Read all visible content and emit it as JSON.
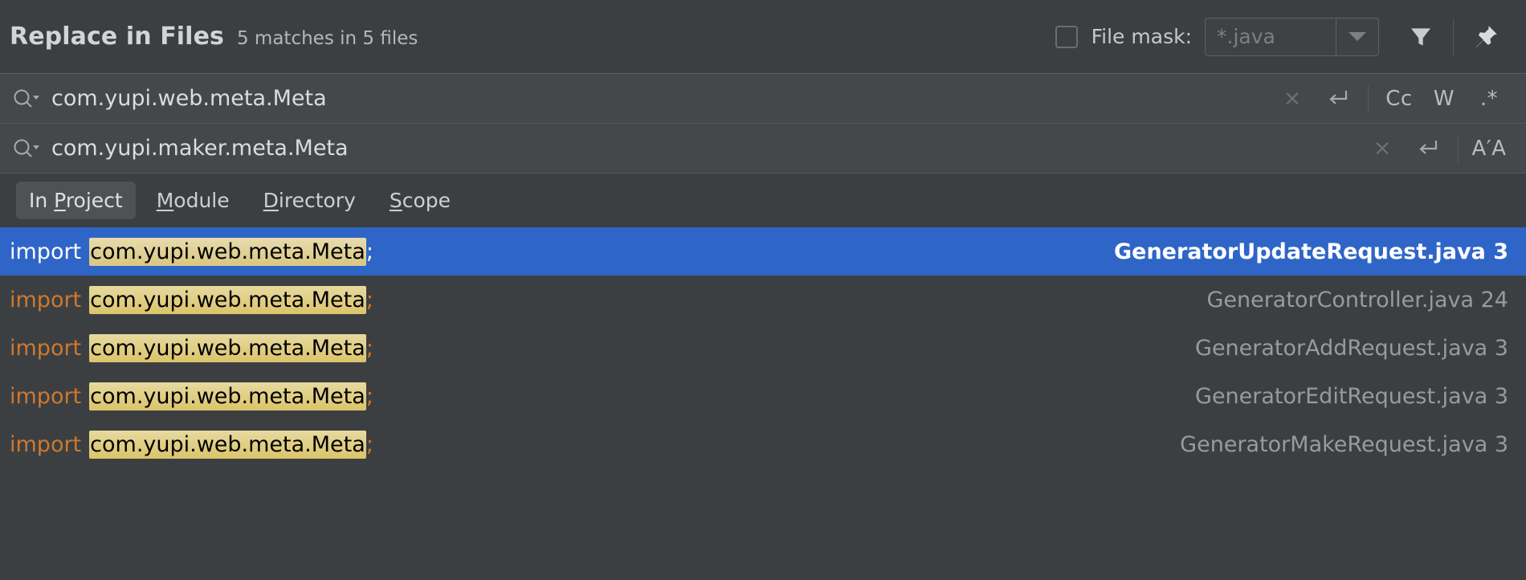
{
  "header": {
    "title": "Replace in Files",
    "match_summary": "5 matches in 5 files",
    "file_mask_label": "File mask:",
    "file_mask_value": "*.java",
    "file_mask_checked": false,
    "filter_icon": "filter-funnel-icon",
    "pin_icon": "pin-icon"
  },
  "search_field": {
    "icon": "search-icon",
    "value": "com.yupi.web.meta.Meta",
    "clear_label": "×",
    "history_label": "↵",
    "toggles": [
      {
        "name": "match-case",
        "label": "Cc"
      },
      {
        "name": "words",
        "label": "W"
      },
      {
        "name": "regex",
        "label": ".*"
      }
    ]
  },
  "replace_field": {
    "icon": "search-icon",
    "value": "com.yupi.maker.meta.Meta",
    "clear_label": "×",
    "history_label": "↵",
    "preserve_case_label": "A′A"
  },
  "scope_tabs": [
    {
      "name": "in-project",
      "pre": "In ",
      "mnemonic": "P",
      "post": "roject",
      "selected": true
    },
    {
      "name": "module",
      "pre": "",
      "mnemonic": "M",
      "post": "odule",
      "selected": false
    },
    {
      "name": "directory",
      "pre": "",
      "mnemonic": "D",
      "post": "irectory",
      "selected": false
    },
    {
      "name": "scope",
      "pre": "",
      "mnemonic": "S",
      "post": "cope",
      "selected": false
    }
  ],
  "results": [
    {
      "keyword": "import",
      "match": "com.yupi.web.meta.Meta",
      "terminator": ";",
      "file": "GeneratorUpdateRequest.java 3",
      "selected": true
    },
    {
      "keyword": "import",
      "match": "com.yupi.web.meta.Meta",
      "terminator": ";",
      "file": "GeneratorController.java 24",
      "selected": false
    },
    {
      "keyword": "import",
      "match": "com.yupi.web.meta.Meta",
      "terminator": ";",
      "file": "GeneratorAddRequest.java 3",
      "selected": false
    },
    {
      "keyword": "import",
      "match": "com.yupi.web.meta.Meta",
      "terminator": ";",
      "file": "GeneratorEditRequest.java 3",
      "selected": false
    },
    {
      "keyword": "import",
      "match": "com.yupi.web.meta.Meta",
      "terminator": ";",
      "file": "GeneratorMakeRequest.java 3",
      "selected": false
    }
  ],
  "colors": {
    "background": "#3c3f41",
    "field_background": "#45484a",
    "selection_blue": "#2f65c7",
    "keyword_orange": "#cc7832",
    "highlight_khaki": "#dbc46a",
    "text_primary": "#d4d4d4",
    "text_muted": "#9a9a9a"
  }
}
